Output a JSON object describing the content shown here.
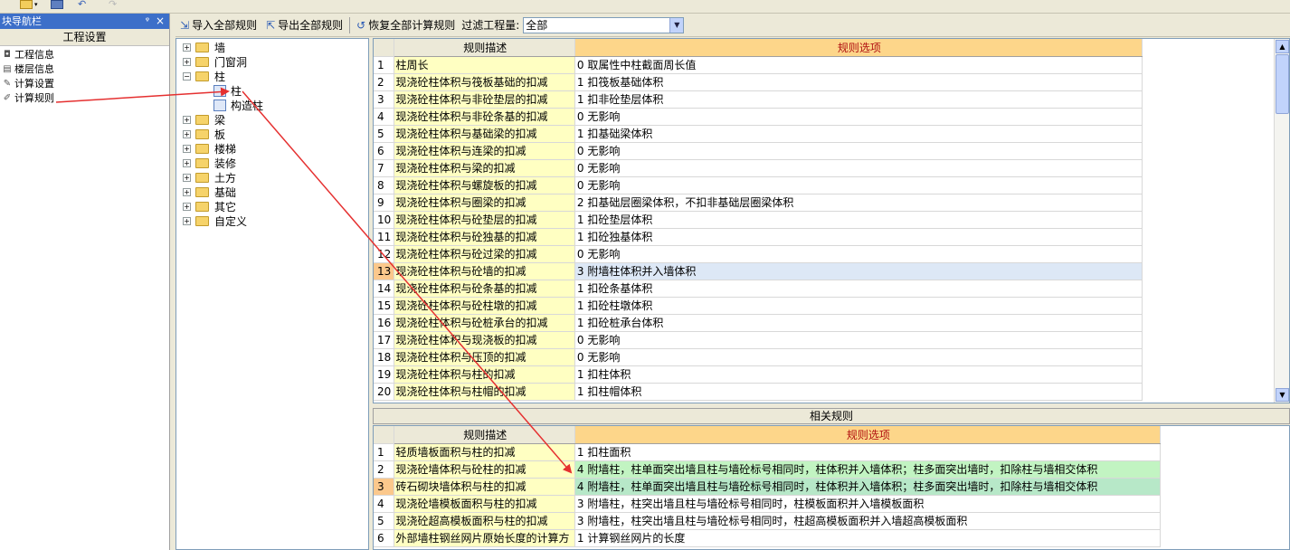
{
  "nav": {
    "title": "块导航栏",
    "pin_glyph": "ᵠ",
    "close_glyph": "×",
    "section": "工程设置",
    "items": [
      {
        "label": "工程信息",
        "icon": "info-icon"
      },
      {
        "label": "楼层信息",
        "icon": "floor-icon"
      },
      {
        "label": "计算设置",
        "icon": "wrench-icon"
      },
      {
        "label": "计算规则",
        "icon": "rule-icon"
      }
    ]
  },
  "toolbar": {
    "import_label": "导入全部规则",
    "export_label": "导出全部规则",
    "restore_label": "恢复全部计算规则",
    "filter_label": "过滤工程量:",
    "filter_value": "全部"
  },
  "tree": {
    "items": [
      {
        "label": "墙",
        "level": 0,
        "expander": "+"
      },
      {
        "label": "门窗洞",
        "level": 0,
        "expander": "+"
      },
      {
        "label": "柱",
        "level": 0,
        "expander": "−"
      },
      {
        "label": "柱",
        "level": 1,
        "expander": ""
      },
      {
        "label": "构造柱",
        "level": 1,
        "expander": ""
      },
      {
        "label": "梁",
        "level": 0,
        "expander": "+"
      },
      {
        "label": "板",
        "level": 0,
        "expander": "+"
      },
      {
        "label": "楼梯",
        "level": 0,
        "expander": "+"
      },
      {
        "label": "装修",
        "level": 0,
        "expander": "+"
      },
      {
        "label": "土方",
        "level": 0,
        "expander": "+"
      },
      {
        "label": "基础",
        "level": 0,
        "expander": "+"
      },
      {
        "label": "其它",
        "level": 0,
        "expander": "+"
      },
      {
        "label": "自定义",
        "level": 0,
        "expander": "+"
      }
    ]
  },
  "main_grid": {
    "headers": {
      "desc": "规则描述",
      "opt": "规则选项"
    },
    "selected_row": 13,
    "rows": [
      {
        "no": "1",
        "desc": "柱周长",
        "opt": "0 取属性中柱截面周长值"
      },
      {
        "no": "2",
        "desc": "现浇砼柱体积与筏板基础的扣减",
        "opt": "1 扣筏板基础体积"
      },
      {
        "no": "3",
        "desc": "现浇砼柱体积与非砼垫层的扣减",
        "opt": "1 扣非砼垫层体积"
      },
      {
        "no": "4",
        "desc": "现浇砼柱体积与非砼条基的扣减",
        "opt": "0   无影响"
      },
      {
        "no": "5",
        "desc": "现浇砼柱体积与基础梁的扣减",
        "opt": "1 扣基础梁体积"
      },
      {
        "no": "6",
        "desc": "现浇砼柱体积与连梁的扣减",
        "opt": "0   无影响"
      },
      {
        "no": "7",
        "desc": "现浇砼柱体积与梁的扣减",
        "opt": "0   无影响"
      },
      {
        "no": "8",
        "desc": "现浇砼柱体积与螺旋板的扣减",
        "opt": "0   无影响"
      },
      {
        "no": "9",
        "desc": "现浇砼柱体积与圈梁的扣减",
        "opt": "2 扣基础层圈梁体积，不扣非基础层圈梁体积"
      },
      {
        "no": "10",
        "desc": "现浇砼柱体积与砼垫层的扣减",
        "opt": "1 扣砼垫层体积"
      },
      {
        "no": "11",
        "desc": "现浇砼柱体积与砼独基的扣减",
        "opt": "1 扣砼独基体积"
      },
      {
        "no": "12",
        "desc": "现浇砼柱体积与砼过梁的扣减",
        "opt": "0   无影响"
      },
      {
        "no": "13",
        "desc": "现浇砼柱体积与砼墙的扣减",
        "opt": "3 附墙柱体积并入墙体积"
      },
      {
        "no": "14",
        "desc": "现浇砼柱体积与砼条基的扣减",
        "opt": "1 扣砼条基体积"
      },
      {
        "no": "15",
        "desc": "现浇砼柱体积与砼柱墩的扣减",
        "opt": "1 扣砼柱墩体积"
      },
      {
        "no": "16",
        "desc": "现浇砼柱体积与砼桩承台的扣减",
        "opt": "1 扣砼桩承台体积"
      },
      {
        "no": "17",
        "desc": "现浇砼柱体积与现浇板的扣减",
        "opt": "0   无影响"
      },
      {
        "no": "18",
        "desc": "现浇砼柱体积与压顶的扣减",
        "opt": "0   无影响"
      },
      {
        "no": "19",
        "desc": "现浇砼柱体积与柱的扣减",
        "opt": "1 扣柱体积"
      },
      {
        "no": "20",
        "desc": "现浇砼柱体积与柱帽的扣减",
        "opt": "1 扣柱帽体积"
      }
    ]
  },
  "related": {
    "title": "相关规则",
    "headers": {
      "desc": "规则描述",
      "opt": "规则选项"
    },
    "rows": [
      {
        "no": "1",
        "desc": "轻质墙板面积与柱的扣减",
        "opt": "1   扣柱面积",
        "style": ""
      },
      {
        "no": "2",
        "desc": "现浇砼墙体积与砼柱的扣减",
        "opt": "4   附墙柱，柱单面突出墙且柱与墙砼标号相同时，柱体积并入墙体积；柱多面突出墙时，扣除柱与墙相交体积",
        "style": "hl"
      },
      {
        "no": "3",
        "desc": "砖石砌块墙体积与柱的扣减",
        "opt": "4   附墙柱，柱单面突出墙且柱与墙砼标号相同时，柱体积并入墙体积；柱多面突出墙时，扣除柱与墙相交体积",
        "style": "hl2 sel2"
      },
      {
        "no": "4",
        "desc": "现浇砼墙模板面积与柱的扣减",
        "opt": "3   附墙柱，柱突出墙且柱与墙砼标号相同时，柱模板面积并入墙模板面积",
        "style": ""
      },
      {
        "no": "5",
        "desc": "现浇砼超高模板面积与柱的扣减",
        "opt": "3   附墙柱，柱突出墙且柱与墙砼标号相同时，柱超高模板面积并入墙超高模板面积",
        "style": ""
      },
      {
        "no": "6",
        "desc": "外部墙柱钢丝网片原始长度的计算方",
        "opt": "1   计算钢丝网片的长度",
        "style": ""
      }
    ]
  },
  "colors": {
    "nav_title": "#3c6fc9",
    "desc_cell": "#ffffc2",
    "option_header": "#fdd68a",
    "selected_row_number": "#fbc88c",
    "annotation_arrow": "#e53030"
  }
}
